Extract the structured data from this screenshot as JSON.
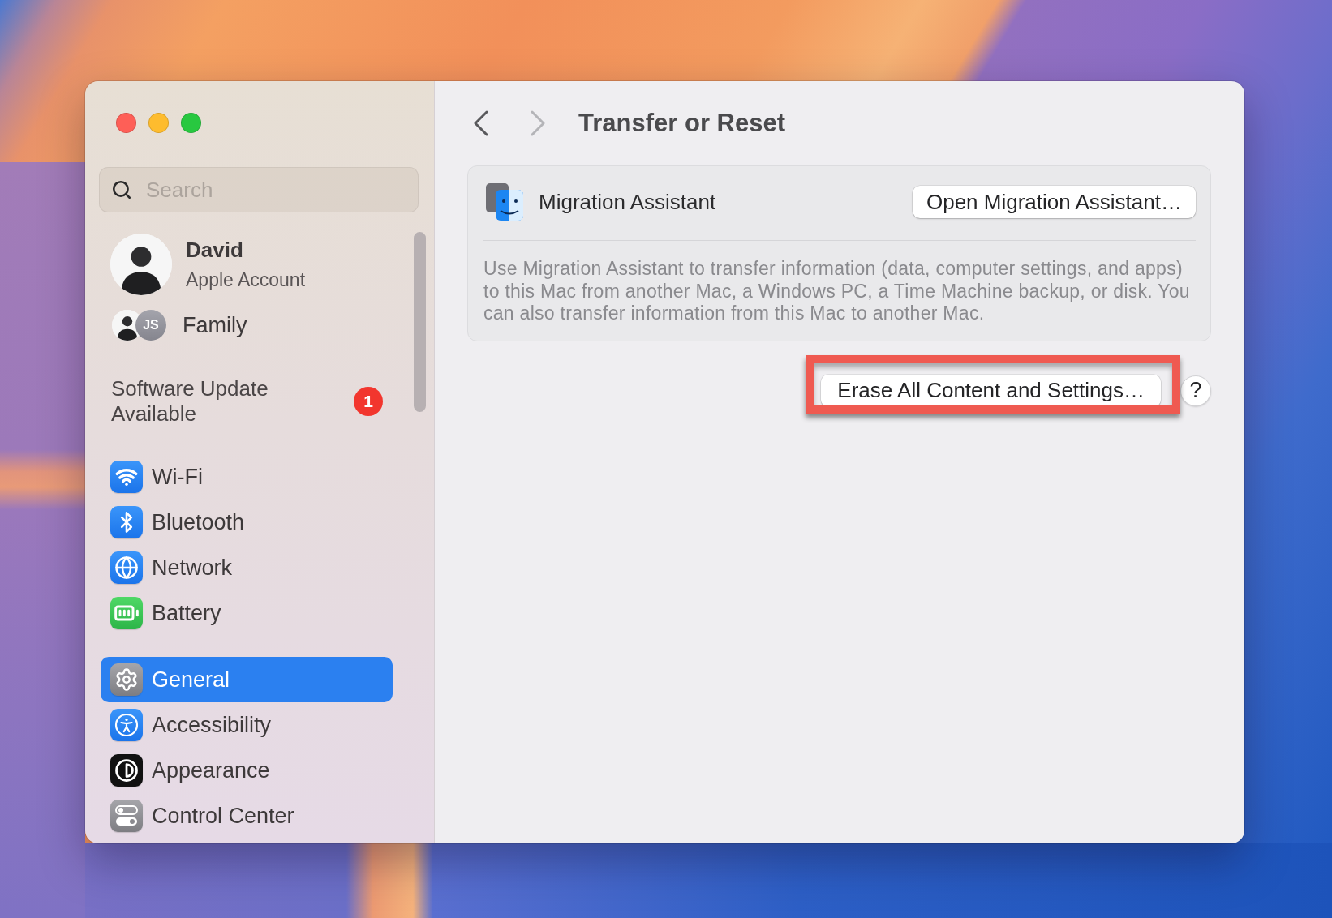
{
  "sidebar": {
    "search": {
      "placeholder": "Search"
    },
    "account": {
      "name": "David",
      "subtitle": "Apple Account"
    },
    "family": {
      "label": "Family",
      "member_initials": "JS"
    },
    "notice": {
      "label": "Software Update Available",
      "badge": "1"
    },
    "sections": [
      {
        "items": [
          {
            "label": "Wi-Fi",
            "selected": false
          },
          {
            "label": "Bluetooth",
            "selected": false
          },
          {
            "label": "Network",
            "selected": false
          },
          {
            "label": "Battery",
            "selected": false
          }
        ]
      },
      {
        "items": [
          {
            "label": "General",
            "selected": true
          },
          {
            "label": "Accessibility",
            "selected": false
          },
          {
            "label": "Appearance",
            "selected": false
          },
          {
            "label": "Control Center",
            "selected": false
          }
        ]
      }
    ]
  },
  "content": {
    "navigation": [
      {
        "kind": "back",
        "disabled": false
      },
      {
        "kind": "forward",
        "disabled": true
      }
    ],
    "title": "Transfer or Reset",
    "migration": {
      "title": "Migration Assistant",
      "button": "Open Migration Assistant…",
      "description": "Use Migration Assistant to transfer information (data, computer settings, and apps) to this Mac from another Mac, a Windows PC, a Time Machine backup, or disk. You can also transfer information from this Mac to another Mac."
    },
    "erase_button": {
      "label": "Erase All Content and Settings…",
      "highlighted": true
    },
    "help_button": {
      "label": "?"
    }
  }
}
